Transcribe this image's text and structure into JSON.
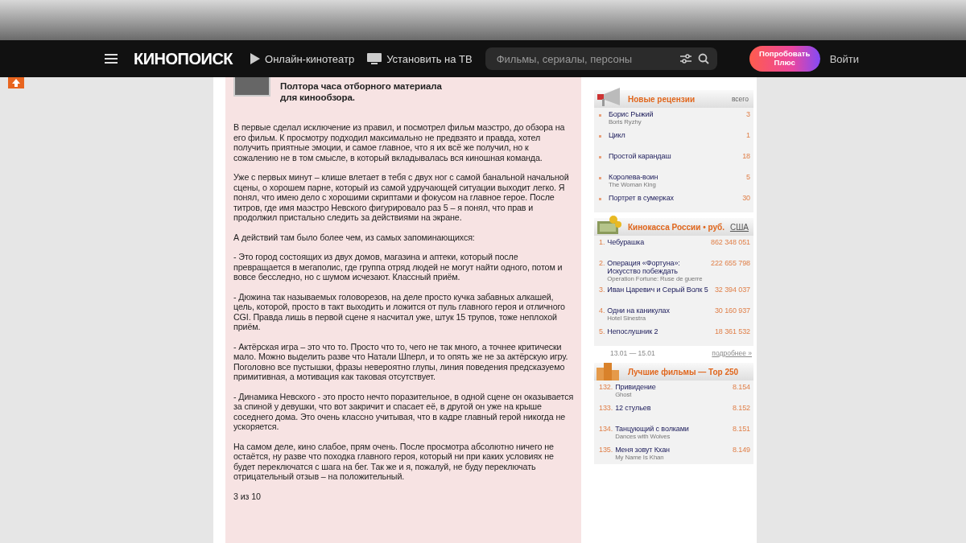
{
  "nav": {
    "logo": "КИНОПОИСК",
    "links": [
      {
        "label": "Онлайн-кинотеатр",
        "kind": "play"
      },
      {
        "label": "Установить на ТВ",
        "kind": "tv"
      }
    ],
    "search": {
      "placeholder": "Фильмы, сериалы, персоны"
    },
    "plus_button": "Попробовать Плюс",
    "login": "Войти"
  },
  "review": {
    "title": "Полтора часа отборного материала для кинообзора.",
    "paragraphs": [
      "В первые сделал исключение из правил, и посмотрел фильм маэстро, до обзора на его фильм. К просмотру подходил максимально не предвзято и правда, хотел получить приятные эмоции, и самое главное, что я их всё же получил, но к сожалению не в том смысле, в который вкладывалась вся киношная команда.",
      "Уже с первых минут – клише влетает в тебя с двух ног с самой банальной начальной сцены, о хорошем парне, который из самой удручающей ситуации выходит легко. Я понял, что имею дело с хорошими скриптами и фокусом на главное герое. После титров, где имя маэстро Невского фигурировало раз 5 – я понял, что прав и продолжил пристально следить за действиями на экране.",
      "А действий там было более чем, из самых запоминающихся:",
      "- Это город состоящих из двух домов, магазина и аптеки, который после превращается в мегаполис, где группа отряд людей не могут найти одного, потом и вовсе бесследно, но с шумом исчезают. Классный приём.",
      "- Дюжина так называемых головорезов, на деле просто кучка забавных алкашей, цель, которой, просто в такт выходить и ложится от пуль главного героя и отличного CGI. Правда лишь в первой сцене я насчитал уже, штук 15 трупов, тоже неплохой приём.",
      "- Актёрская игра – это что то. Просто что то, чего не так много, а точнее критически мало. Можно выделить разве что Натали Шперл, и то опять же не за актёрскую игру. Поголовно все пустышки, фразы невероятно глупы, линия поведения предсказуемо примитивная, а мотивация как таковая отсутствует.",
      "- Динамика Невского - это просто нечто поразительное, в одной сцене он оказывается за спиной у девушки, что вот закричит и спасает её, в другой он уже на крыше соседнего дома. Это очень классно учитывая, что в кадре главный герой никогда не ускоряется.",
      "На самом деле, кино слабое, прям очень. После просмотра абсолютно ничего не остаётся, ну разве что походка главного героя, который ни при каких условиях не будет переключатся с шага на бег. Так же и я, пожалуй, не буду переключать отрицательный отзыв – на положительный."
    ],
    "rating": "3 из 10"
  },
  "sidebar": {
    "reviews": {
      "title": "Новые рецензии",
      "header_note": "всего",
      "items": [
        {
          "title": "Борис Рыжий",
          "subtitle": "Boris Ryzhy",
          "count": "3"
        },
        {
          "title": "Цикл",
          "count": "1"
        },
        {
          "title": "Простой карандаш",
          "count": "18"
        },
        {
          "title": "Королева-воин",
          "subtitle": "The Woman King",
          "count": "5"
        },
        {
          "title": "Портрет в сумерках",
          "count": "30"
        }
      ]
    },
    "box_office": {
      "title": "Кинокасса России • руб.",
      "link": "США",
      "items": [
        {
          "rank": "1.",
          "title": "Чебурашка",
          "value": "862 348 051"
        },
        {
          "rank": "2.",
          "title": "Операция «Фортуна»: Искусство побеждать",
          "subtitle": "Operation Fortune: Ruse de guerre",
          "value": "222 655 798"
        },
        {
          "rank": "3.",
          "title": "Иван Царевич и Серый Волк 5",
          "value": "32 394 037"
        },
        {
          "rank": "4.",
          "title": "Одни на каникулах",
          "subtitle": "Hotel Sinestra",
          "value": "30 160 937"
        },
        {
          "rank": "5.",
          "title": "Непослушник 2",
          "value": "18 361 532"
        }
      ],
      "dates": "13.01 — 15.01",
      "more": "подробнее »"
    },
    "top250": {
      "title": "Лучшие фильмы — Top 250",
      "items": [
        {
          "rank": "132.",
          "title": "Привидение",
          "subtitle": "Ghost",
          "value": "8.154"
        },
        {
          "rank": "133.",
          "title": "12 стульев",
          "value": "8.152"
        },
        {
          "rank": "134.",
          "title": "Танцующий с волками",
          "subtitle": "Dances with Wolves",
          "value": "8.151"
        },
        {
          "rank": "135.",
          "title": "Меня зовут Кхан",
          "subtitle": "My Name Is Khan",
          "value": "8.149"
        }
      ]
    }
  }
}
